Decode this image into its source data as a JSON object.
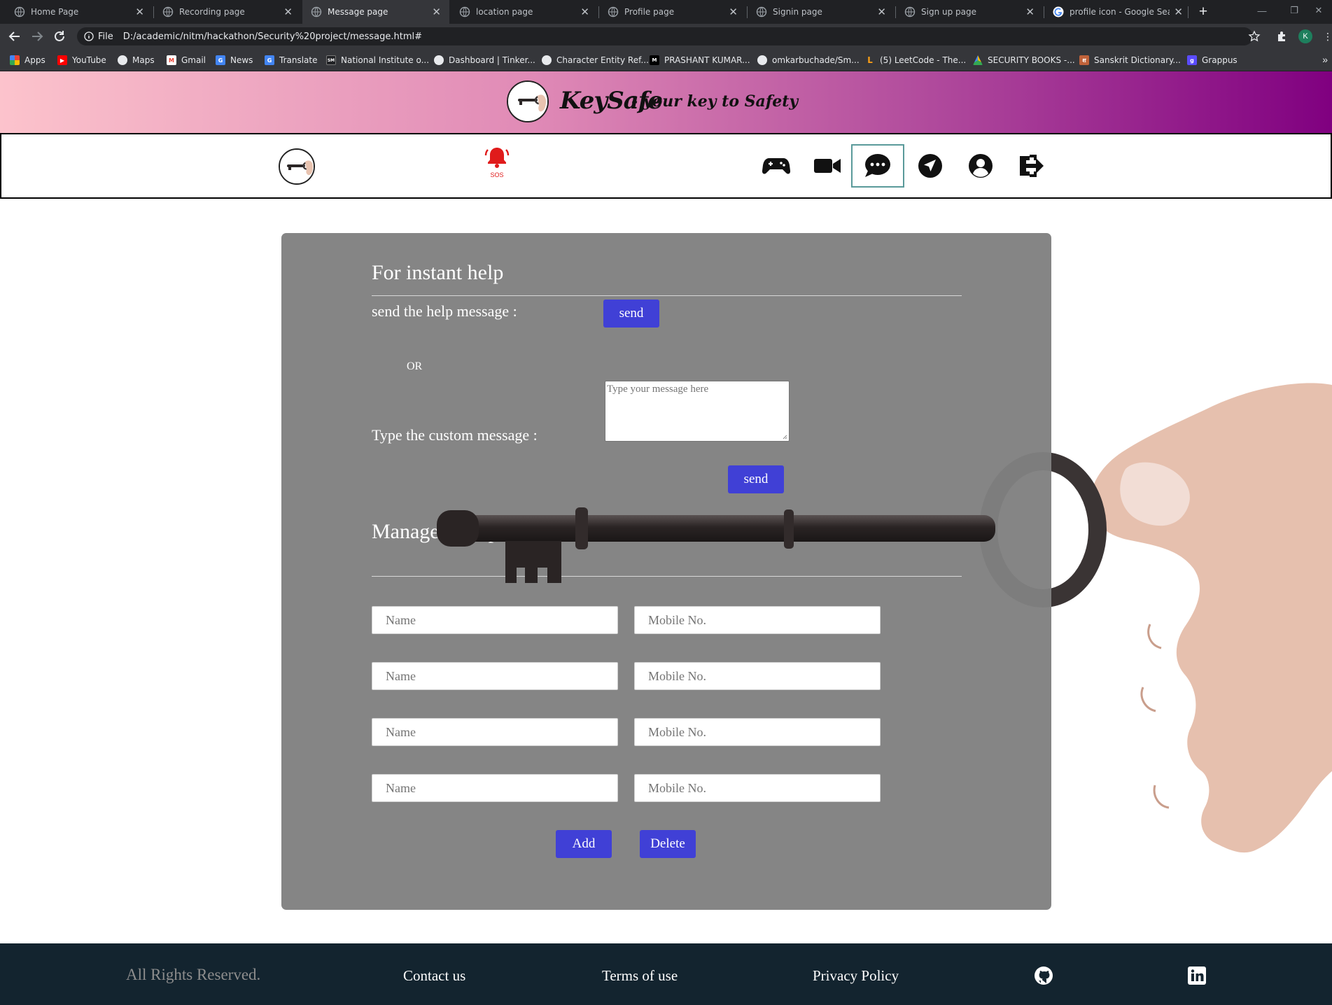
{
  "browser": {
    "tabs": [
      {
        "title": "Home Page"
      },
      {
        "title": "Recording page"
      },
      {
        "title": "Message page"
      },
      {
        "title": "location page"
      },
      {
        "title": "Profile page"
      },
      {
        "title": "Signin page"
      },
      {
        "title": "Sign up page"
      },
      {
        "title": "profile icon - Google Search"
      }
    ],
    "active_tab": "Message page",
    "scheme_label": "File",
    "url": "D:/academic/nitm/hackathon/Security%20project/message.html#",
    "profile_initial": "K",
    "bookmarks": [
      {
        "label": "Apps",
        "icon": "apps-grid-icon"
      },
      {
        "label": "YouTube",
        "icon": "youtube-icon"
      },
      {
        "label": "Maps",
        "icon": "globe-icon"
      },
      {
        "label": "Gmail",
        "icon": "gmail-icon"
      },
      {
        "label": "News",
        "icon": "news-icon"
      },
      {
        "label": "Translate",
        "icon": "translate-icon"
      },
      {
        "label": "National Institute o...",
        "icon": "site-icon"
      },
      {
        "label": "Dashboard | Tinker...",
        "icon": "globe-icon"
      },
      {
        "label": "Character Entity Ref...",
        "icon": "globe-icon"
      },
      {
        "label": "PRASHANT KUMAR...",
        "icon": "medium-icon"
      },
      {
        "label": "omkarbuchade/Sm...",
        "icon": "globe-icon"
      },
      {
        "label": "(5) LeetCode - The...",
        "icon": "leetcode-icon"
      },
      {
        "label": "SECURITY BOOKS -...",
        "icon": "drive-icon"
      },
      {
        "label": "Sanskrit Dictionary...",
        "icon": "dictionary-icon"
      },
      {
        "label": "Grappus",
        "icon": "grappus-icon"
      }
    ]
  },
  "header": {
    "brand": "KeySafe",
    "tagline": "- your key to Safety"
  },
  "nav": {
    "sos_label": "SOS",
    "items": [
      {
        "icon": "gamepad-icon",
        "name": "games"
      },
      {
        "icon": "video-camera-icon",
        "name": "recording"
      },
      {
        "icon": "chat-bubble-icon",
        "name": "message",
        "active": true
      },
      {
        "icon": "location-arrow-icon",
        "name": "location"
      },
      {
        "icon": "user-circle-icon",
        "name": "profile"
      },
      {
        "icon": "sign-out-icon",
        "name": "logout"
      }
    ]
  },
  "instant_help": {
    "title": "For instant help",
    "help_label": "send the help message :",
    "send_label": "send",
    "or_label": "OR",
    "custom_label": "Type the custom message :",
    "custom_placeholder": "Type your message here",
    "custom_send_label": "send"
  },
  "contacts": {
    "title": "Manage your preference contacts:",
    "rows": [
      {
        "name_placeholder": "Name",
        "mobile_placeholder": "Mobile No."
      },
      {
        "name_placeholder": "Name",
        "mobile_placeholder": "Mobile No."
      },
      {
        "name_placeholder": "Name",
        "mobile_placeholder": "Mobile No."
      },
      {
        "name_placeholder": "Name",
        "mobile_placeholder": "Mobile No."
      }
    ],
    "add_label": "Add",
    "delete_label": "Delete"
  },
  "footer": {
    "copyright": "All Rights Reserved.",
    "links": [
      "Contact us",
      "Terms of use",
      "Privacy Policy"
    ],
    "social": [
      "github-icon",
      "linkedin-icon"
    ]
  },
  "colors": {
    "accent_button": "#4040d6",
    "panel": "#808080",
    "footer": "#13242f",
    "sos": "#e01b1b",
    "banner_start": "#fcc3cc",
    "banner_end": "#800080"
  }
}
